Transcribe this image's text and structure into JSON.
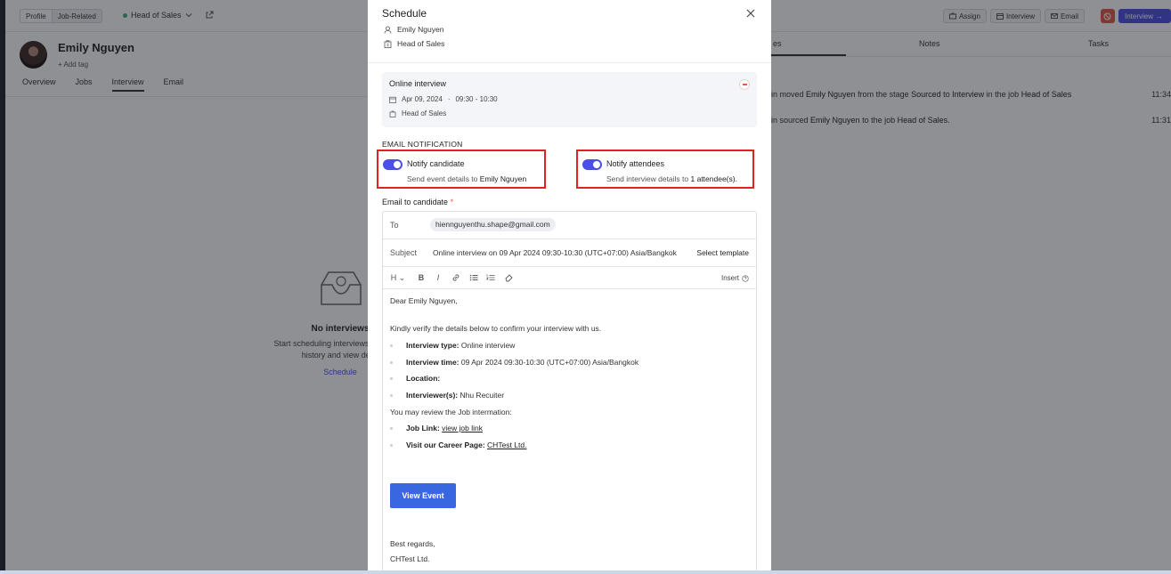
{
  "topbar": {
    "seg_profile": "Profile",
    "seg_job": "Job-Related",
    "job_name": "Head of Sales",
    "actions": {
      "assign": "Assign",
      "interview": "Interview",
      "email": "Email",
      "primary": "Interview"
    }
  },
  "candidate": {
    "name": "Emily Nguyen",
    "add_tag": "+ Add tag"
  },
  "bg_tabs": [
    "Overview",
    "Jobs",
    "Interview",
    "Email"
  ],
  "empty": {
    "title": "No interviews",
    "desc_line1": "Start scheduling interviews to track th",
    "desc_line2": "history and view detai",
    "link": "Schedule"
  },
  "right_tabs": {
    "t1": "es",
    "t2": "Notes",
    "t3": "Tasks"
  },
  "activity": [
    {
      "pre": "in moved ",
      "name": "Emily Nguyen",
      "mid": " from the stage ",
      "s1": "Sourced",
      "mid2": " to ",
      "s2": "Interview",
      "mid3": " in the job ",
      "job": "Head of Sales",
      "time": "11:34"
    },
    {
      "pre": "in sourced ",
      "name": "Emily Nguyen",
      "mid": " to the job ",
      "job": "Head of Sales.",
      "time": "11:31"
    }
  ],
  "modal": {
    "title": "Schedule",
    "candidate": "Emily Nguyen",
    "job": "Head of Sales",
    "event": {
      "type": "Online interview",
      "date": "Apr 09, 2024",
      "sep": "·",
      "time": "09:30 - 10:30",
      "job": "Head of Sales"
    },
    "section_label": "EMAIL NOTIFICATION",
    "notify_candidate": {
      "title": "Notify candidate",
      "desc": "Send event details to ",
      "target": "Emily Nguyen",
      "enabled": true
    },
    "notify_attendees": {
      "title": "Notify attendees",
      "desc": "Send interview details to ",
      "target": "1 attendee(s).",
      "enabled": true
    },
    "email_label": "Email to candidate",
    "required_mark": "*",
    "to_label": "To",
    "to_value": "hiennguyenthu.shape@gmail.com",
    "subject_label": "Subject",
    "subject_value": "Online interview on 09 Apr 2024 09:30-10:30 (UTC+07:00) Asia/Bangkok",
    "select_template": "Select template",
    "toolbar": {
      "heading": "H",
      "bold": "B",
      "italic": "I",
      "insert": "Insert"
    },
    "body": {
      "greeting": "Dear Emily Nguyen,",
      "intro": "Kindly verify the details below to confirm your interview with us.",
      "items": [
        {
          "label": "Interview type:",
          "value": " Online interview"
        },
        {
          "label": "Interview time:",
          "value": " 09 Apr 2024 09:30-10:30 (UTC+07:00) Asia/Bangkok"
        },
        {
          "label": "Location:",
          "value": ""
        },
        {
          "label": "Interviewer(s):",
          "value": " Nhu Recuiter"
        }
      ],
      "job_info": "You may review the Job intermation:",
      "job_link_label": "Job Link:",
      "job_link": "view job link",
      "career_label": "Visit our Career Page:",
      "career_link": "CHTest Ltd.",
      "button": "View Event",
      "regards": "Best regards,",
      "company": "CHTest Ltd."
    }
  },
  "colors": {
    "accent": "#4b4ee8",
    "highlight": "#e0211f",
    "button": "#3867e0",
    "overlay": "rgba(20,22,30,0.48)"
  }
}
